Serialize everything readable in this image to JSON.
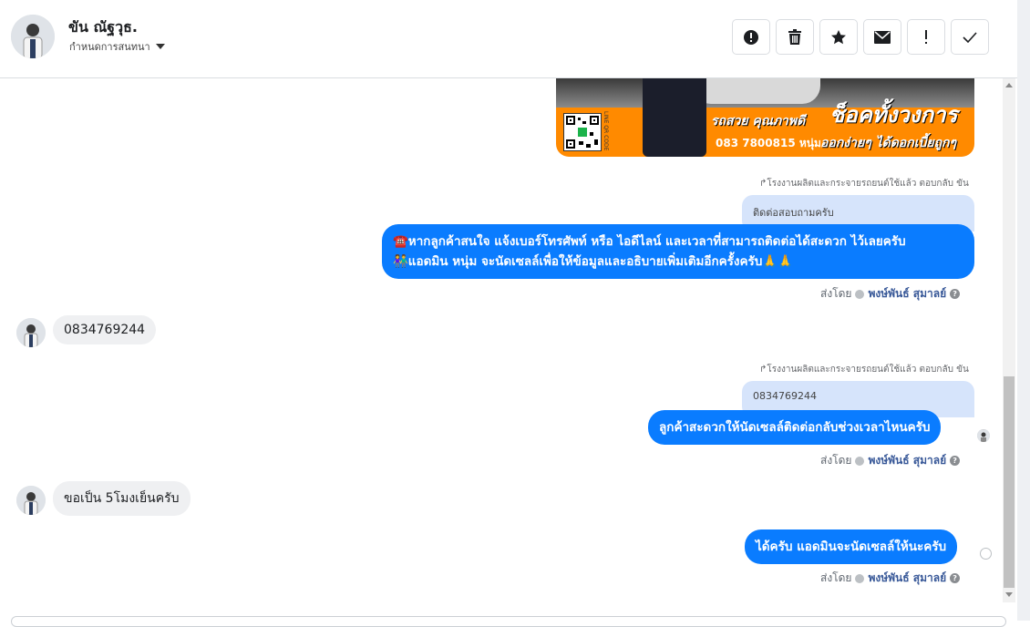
{
  "header": {
    "name": "ขัน ณัฐวุธ.",
    "subtitle": "กำหนดการสนทนา",
    "toolbar": [
      "spam-icon",
      "trash-icon",
      "star-icon",
      "envelope-icon",
      "exclamation-icon",
      "check-icon"
    ]
  },
  "ad": {
    "brand": "ช็อคทั้งวงการ",
    "tagline": "รถสวย คุณภาพดี",
    "phone": "083 7800815 หนุ่ม",
    "slogan": "ออกง่ายๆ ได้ดอกเบี้ยถูกๆ",
    "qr_label": "LINE QR CODE"
  },
  "messages": {
    "meta1": "↱โรงงานผลิตและกระจายรถยนต์ใช้แล้ว ตอบกลับ ขัน",
    "quote1": "ติดต่อสอบถามครับ",
    "out1_line1": "☎️หากลูกค้าสนใจ แจ้งเบอร์โทรศัพท์ หรือ ไอดีไลน์ และเวลาที่สามารถติดต่อได้สะดวก ไว้เลยครับ",
    "out1_line2": "👫แอดมิน หนุ่ม จะนัดเซลล์เพื่อให้ข้อมูลและอธิบายเพิ่มเติมอีกครั้งครับ🙏🙏",
    "sentby_label": "ส่งโดย",
    "sentby_name": "พงษ์พันธ์ สุมาลย์",
    "in1": "0834769244",
    "meta2": "↱โรงงานผลิตและกระจายรถยนต์ใช้แล้ว ตอบกลับ ขัน",
    "quote2": "0834769244",
    "out2": "ลูกค้าสะดวกให้นัดเซลล์ติดต่อกลับช่วงเวลาไหนครับ",
    "in2": "ขอเป็น 5โมงเย็นครับ",
    "out3": "ได้ครับ แอดมินจะนัดเซลล์ให้นะครับ"
  },
  "colors": {
    "outgoing": "#0a7cff",
    "incoming": "#eff0f2",
    "quote": "#d6e4fb",
    "link": "#385898"
  }
}
